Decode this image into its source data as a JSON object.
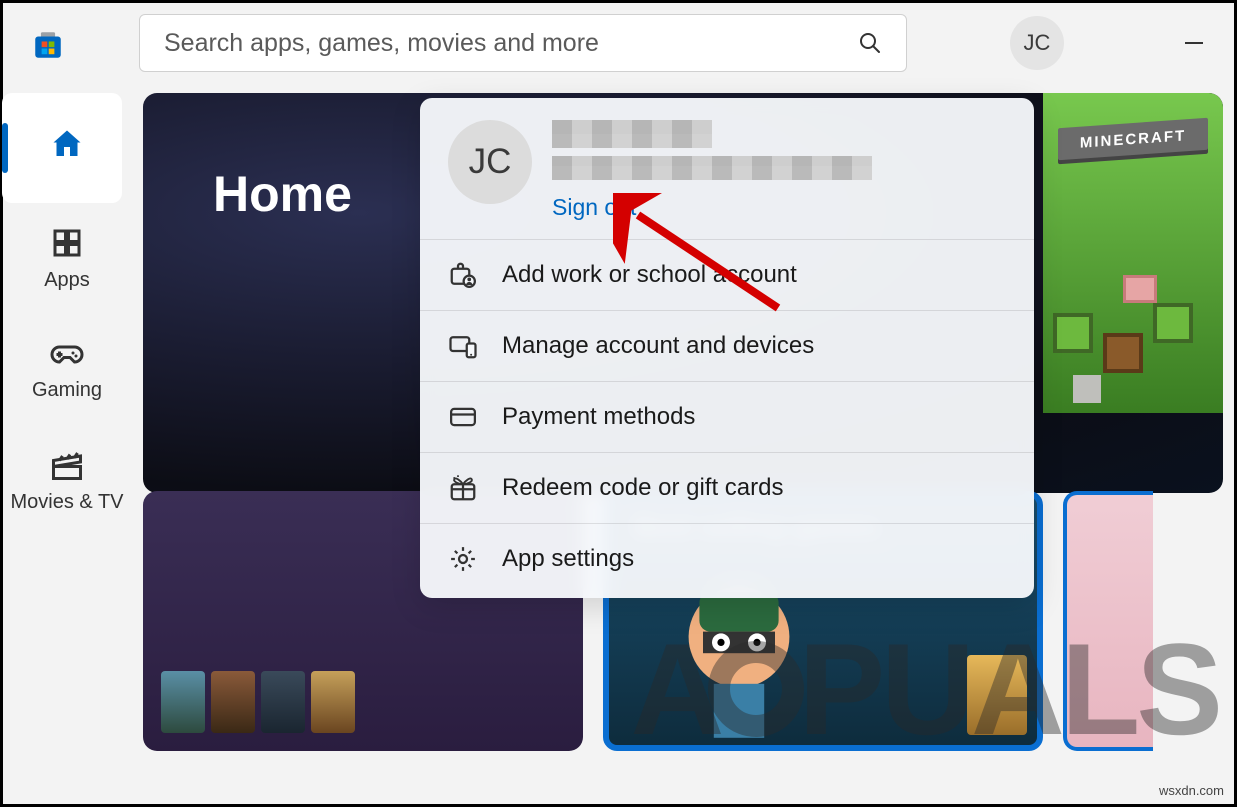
{
  "search": {
    "placeholder": "Search apps, games, movies and more"
  },
  "user": {
    "initials": "JC",
    "sign_out": "Sign out"
  },
  "sidebar": {
    "home": "",
    "apps": "Apps",
    "gaming": "Gaming",
    "movies": "Movies & TV"
  },
  "hero": {
    "title": "Home",
    "featured_game": "MINECRAFT"
  },
  "cards": {
    "best_selling_games": "Best selling games"
  },
  "flyout": {
    "add_account": "Add work or school account",
    "manage_account": "Manage account and devices",
    "payment": "Payment methods",
    "redeem": "Redeem code or gift cards",
    "settings": "App settings"
  },
  "watermark": {
    "appuals": "APPUALS",
    "wsxdn": "wsxdn.com"
  }
}
